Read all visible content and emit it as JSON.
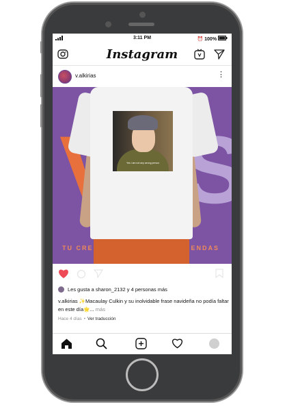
{
  "status_bar": {
    "time": "3:11 PM",
    "battery": "100%"
  },
  "app": {
    "title": "Instagram"
  },
  "post": {
    "username": "v.alkirias",
    "photo": {
      "big_text_left": "V",
      "big_text_right": "S",
      "tagline_left": "TU CRE",
      "tagline_right": "PRENDAS",
      "print_caption": "Yes I am not any wrong person"
    },
    "likes_text": "Les gusta a sharon_2132 y 4 personas más",
    "caption_user": "v.alkirias",
    "caption_body": " ✨Macaulay Culkin y su inolvidable frase navideña no podía faltar en este día🌟... ",
    "caption_more": "más",
    "timestamp": "Hace 4 días",
    "translate": "Ver traducción"
  },
  "colors": {
    "photo_bg": "#7c54a3",
    "accent_orange": "#e8703d",
    "like_red": "#ed4956"
  }
}
